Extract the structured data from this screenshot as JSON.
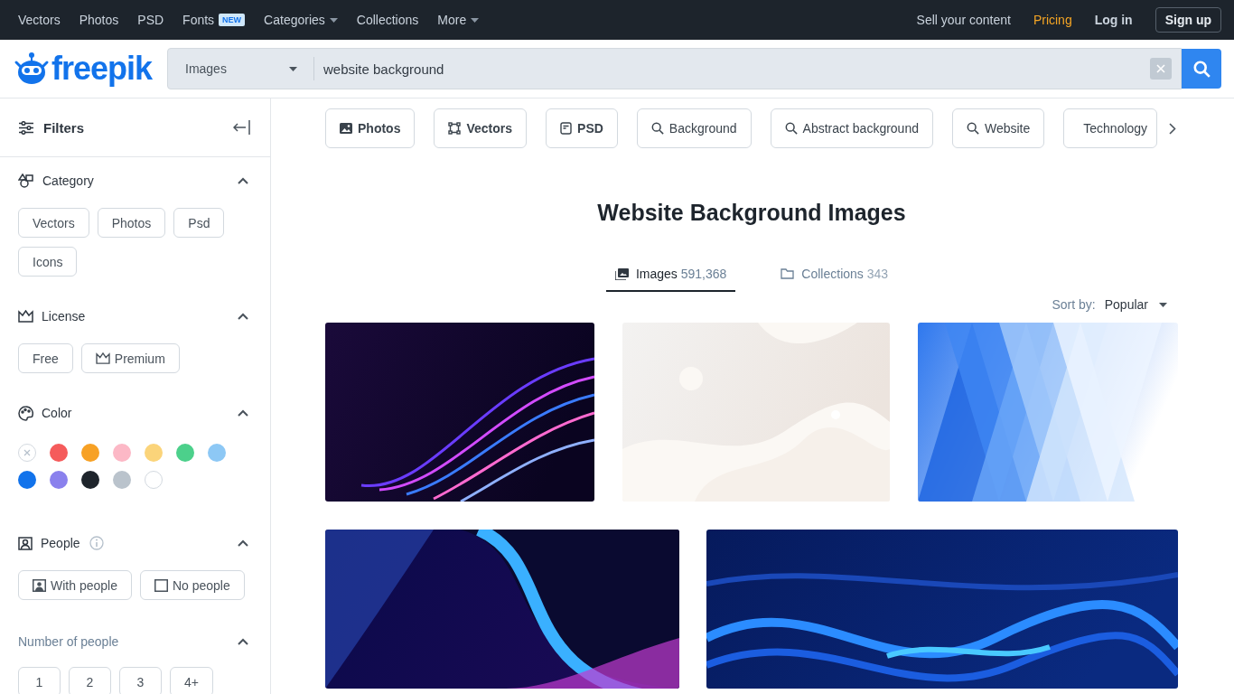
{
  "top_nav": {
    "left": [
      {
        "label": "Vectors",
        "kind": "link"
      },
      {
        "label": "Photos",
        "kind": "link"
      },
      {
        "label": "PSD",
        "kind": "link"
      },
      {
        "label": "Fonts",
        "kind": "badge",
        "badge": "NEW"
      },
      {
        "label": "Categories",
        "kind": "dropdown"
      },
      {
        "label": "Collections",
        "kind": "link"
      },
      {
        "label": "More",
        "kind": "dropdown"
      }
    ],
    "right": [
      {
        "label": "Sell your content",
        "kind": "plain"
      },
      {
        "label": "Pricing",
        "kind": "highlight"
      },
      {
        "label": "Log in",
        "kind": "bold"
      },
      {
        "label": "Sign up",
        "kind": "outline"
      }
    ]
  },
  "logo": "freepik",
  "search": {
    "scope": "Images",
    "value": "website background"
  },
  "sidebar": {
    "title": "Filters",
    "sections": [
      {
        "title": "Category",
        "kind": "chips",
        "dimmed": false,
        "expanded": true,
        "info": false,
        "options": [
          {
            "label": "Vectors",
            "kind": "plain"
          },
          {
            "label": "Photos",
            "kind": "plain"
          },
          {
            "label": "Psd",
            "kind": "plain"
          },
          {
            "label": "Icons",
            "kind": "plain"
          }
        ]
      },
      {
        "title": "License",
        "kind": "chips",
        "dimmed": false,
        "expanded": true,
        "info": false,
        "options": [
          {
            "label": "Free",
            "kind": "plain"
          },
          {
            "label": "Premium",
            "kind": "premium"
          }
        ]
      },
      {
        "title": "Color",
        "kind": "colors",
        "dimmed": false,
        "expanded": true,
        "info": false,
        "colors": [
          {
            "kind": "none",
            "color": "#ffffff"
          },
          {
            "kind": "swatch",
            "color": "#f55b5b"
          },
          {
            "kind": "swatch",
            "color": "#f7a125"
          },
          {
            "kind": "swatch",
            "color": "#fcb8c6"
          },
          {
            "kind": "swatch",
            "color": "#fbd47a"
          },
          {
            "kind": "swatch",
            "color": "#4cd08b"
          },
          {
            "kind": "swatch",
            "color": "#8dc8f5"
          },
          {
            "kind": "swatch",
            "color": "#1273eb"
          },
          {
            "kind": "swatch",
            "color": "#8a81ed"
          },
          {
            "kind": "swatch",
            "color": "#1e242b"
          },
          {
            "kind": "swatch",
            "color": "#bac3cc"
          },
          {
            "kind": "swatch",
            "color": "#ffffff"
          }
        ]
      },
      {
        "title": "People",
        "kind": "chips",
        "dimmed": false,
        "expanded": true,
        "info": true,
        "options": [
          {
            "label": "With people",
            "kind": "with-people"
          },
          {
            "label": "No people",
            "kind": "no-people"
          }
        ]
      },
      {
        "title": "Number of people",
        "kind": "chips",
        "dimmed": true,
        "expanded": true,
        "info": false,
        "options": [
          {
            "label": "1",
            "kind": "plain"
          },
          {
            "label": "2",
            "kind": "plain"
          },
          {
            "label": "3",
            "kind": "plain"
          },
          {
            "label": "4+",
            "kind": "plain"
          }
        ]
      }
    ]
  },
  "chips": [
    {
      "label": "Photos",
      "kind": "photos"
    },
    {
      "label": "Vectors",
      "kind": "vectors"
    },
    {
      "label": "PSD",
      "kind": "psd"
    },
    {
      "label": "Background",
      "kind": "search"
    },
    {
      "label": "Abstract background",
      "kind": "search"
    },
    {
      "label": "Website",
      "kind": "search"
    },
    {
      "label": "Technology",
      "kind": "search"
    }
  ],
  "title": "Website Background Images",
  "tabs": [
    {
      "label": "Images",
      "count": "591,368",
      "selected": true,
      "kind": "images"
    },
    {
      "label": "Collections",
      "count": "343",
      "selected": false,
      "kind": "collections"
    }
  ],
  "sort": {
    "label": "Sort by:",
    "value": "Popular"
  }
}
